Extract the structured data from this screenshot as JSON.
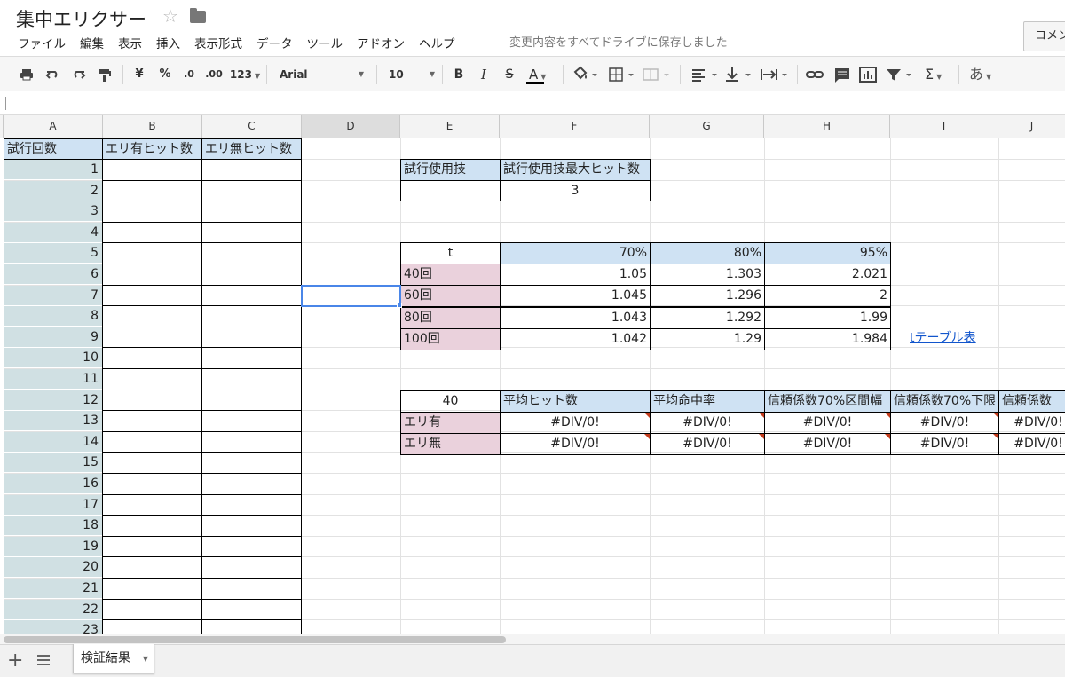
{
  "doc": {
    "title": "集中エリクサー",
    "save_status": "変更内容をすべてドライブに保存しました",
    "comment_button": "コメント"
  },
  "menu": [
    "ファイル",
    "編集",
    "表示",
    "挿入",
    "表示形式",
    "データ",
    "ツール",
    "アドオン",
    "ヘルプ"
  ],
  "toolbar": {
    "currency": "¥",
    "percent": "%",
    "dec_decrease": ".0",
    "dec_increase": ".00",
    "more_formats": "123",
    "font": "Arial",
    "font_size": "10",
    "bold": "B",
    "italic": "I",
    "strike": "S",
    "text_color": "A",
    "input_tools": "あ"
  },
  "columns": [
    "A",
    "B",
    "C",
    "D",
    "E",
    "F",
    "G",
    "H",
    "I",
    "J"
  ],
  "selected_column": "D",
  "col_a": {
    "header": "試行回数",
    "rows": [
      "1",
      "2",
      "3",
      "4",
      "5",
      "6",
      "7",
      "8",
      "9",
      "10",
      "11",
      "12",
      "13",
      "14",
      "15",
      "16",
      "17",
      "18",
      "19",
      "20",
      "21",
      "22",
      "23"
    ]
  },
  "col_b_header": "エリ有ヒット数",
  "col_c_header": "エリ無ヒット数",
  "trial_table": {
    "header_e": "試行使用技",
    "header_f": "試行使用技最大ヒット数",
    "value_e": "",
    "value_f": "3"
  },
  "t_table": {
    "corner": "t",
    "headers": [
      "70%",
      "80%",
      "95%"
    ],
    "rows": [
      {
        "label": "40回",
        "values": [
          "1.05",
          "1.303",
          "2.021"
        ]
      },
      {
        "label": "60回",
        "values": [
          "1.045",
          "1.296",
          "2"
        ]
      },
      {
        "label": "80回",
        "values": [
          "1.043",
          "1.292",
          "1.99"
        ]
      },
      {
        "label": "100回",
        "values": [
          "1.042",
          "1.29",
          "1.984"
        ]
      }
    ],
    "link": "tテーブル表"
  },
  "stats_table": {
    "corner": "40",
    "headers": [
      "平均ヒット数",
      "平均命中率",
      "信頼係数70%区間幅",
      "信頼係数70%下限",
      "信頼係数"
    ],
    "rows": [
      {
        "label": "エリ有",
        "values": [
          "#DIV/0!",
          "#DIV/0!",
          "#DIV/0!",
          "#DIV/0!",
          "#DIV/0!"
        ]
      },
      {
        "label": "エリ無",
        "values": [
          "#DIV/0!",
          "#DIV/0!",
          "#DIV/0!",
          "#DIV/0!",
          "#DIV/0!"
        ]
      }
    ]
  },
  "sheet_tab": "検証結果",
  "colors": {
    "header_blue": "#cfe2f3",
    "row_label_pink": "#ead1dc",
    "col_a_teal": "#d0e0e3",
    "selection": "#4a86e8",
    "error_triangle": "#c43c1c"
  }
}
